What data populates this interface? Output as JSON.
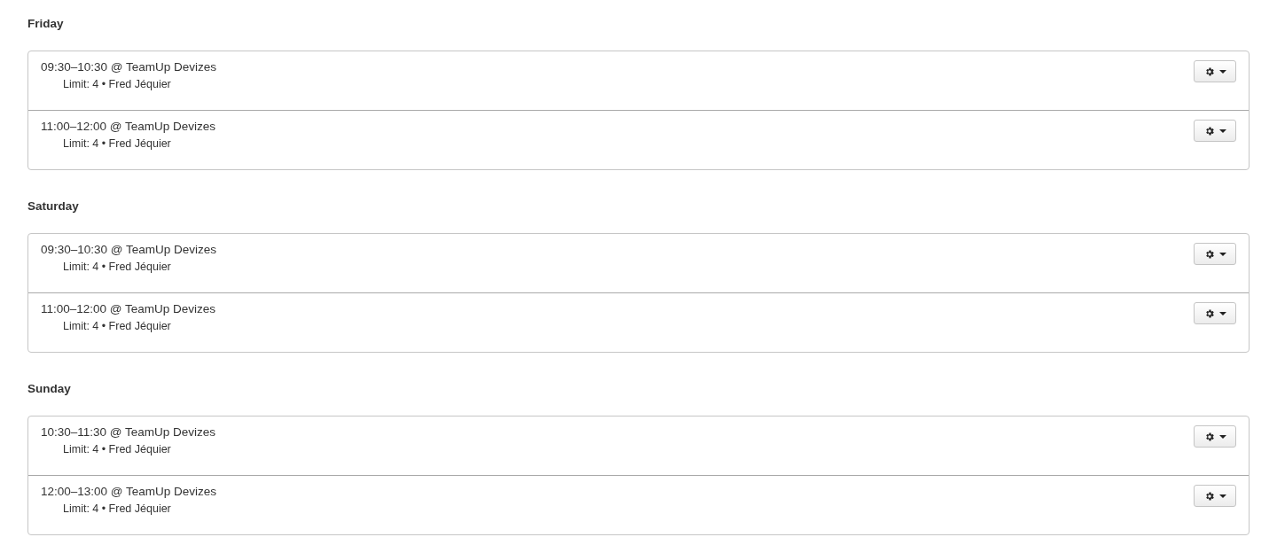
{
  "days": [
    {
      "heading": "Friday",
      "sessions": [
        {
          "title": "09:30–10:30 @ TeamUp Devizes",
          "details": "Limit: 4 • Fred Jéquier"
        },
        {
          "title": "11:00–12:00 @ TeamUp Devizes",
          "details": "Limit: 4 • Fred Jéquier"
        }
      ]
    },
    {
      "heading": "Saturday",
      "sessions": [
        {
          "title": "09:30–10:30 @ TeamUp Devizes",
          "details": "Limit: 4 • Fred Jéquier"
        },
        {
          "title": "11:00–12:00 @ TeamUp Devizes",
          "details": "Limit: 4 • Fred Jéquier"
        }
      ]
    },
    {
      "heading": "Sunday",
      "sessions": [
        {
          "title": "10:30–11:30 @ TeamUp Devizes",
          "details": "Limit: 4 • Fred Jéquier"
        },
        {
          "title": "12:00–13:00 @ TeamUp Devizes",
          "details": "Limit: 4 • Fred Jéquier"
        }
      ]
    }
  ]
}
